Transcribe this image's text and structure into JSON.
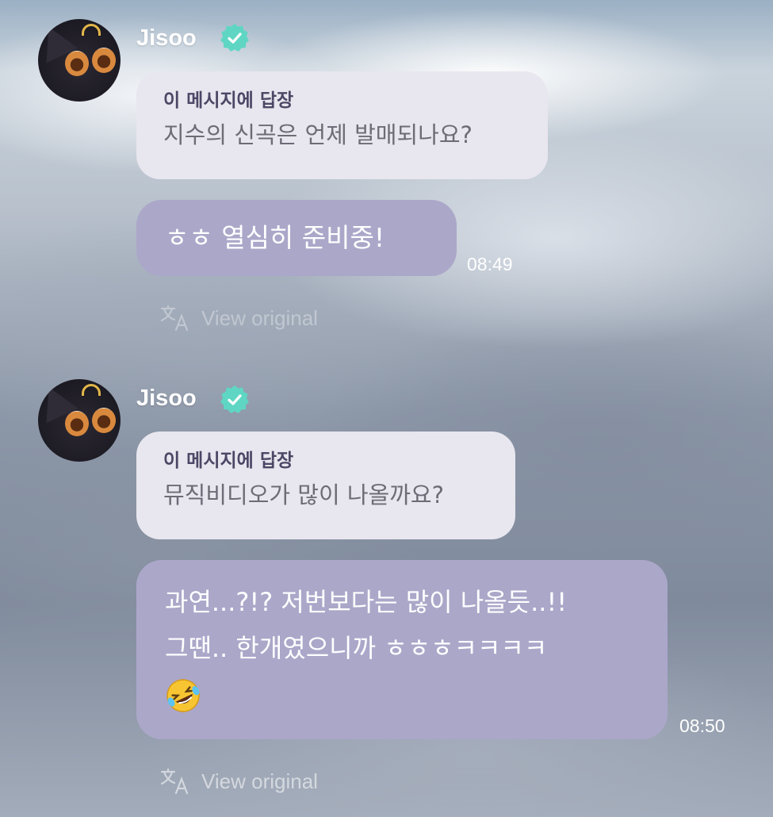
{
  "messages": [
    {
      "sender": "Jisoo",
      "verified": true,
      "reply_label": "이 메시지에 답장",
      "reply_text": "지수의 신곡은 언제 발매되나요?",
      "text": "ㅎㅎ 열심히 준비중!",
      "time": "08:49",
      "view_original": "View original"
    },
    {
      "sender": "Jisoo",
      "verified": true,
      "reply_label": "이 메시지에 답장",
      "reply_text": "뮤직비디오가 많이 나올까요?",
      "text_lines": [
        "과연...?!? 저번보다는 많이 나올듯..!!",
        "그땐.. 한개였으니까 ㅎㅎㅎㅋㅋㅋㅋ"
      ],
      "emoji": "rolling-on-the-floor-laughing",
      "time": "08:50",
      "view_original": "View original"
    }
  ],
  "colors": {
    "bubble": "#aba7c9",
    "reply_bubble": "#e8e6ee",
    "verified": "#5fd6c4"
  },
  "icons": [
    "verified-badge-icon",
    "translate-icon",
    "avatar"
  ]
}
